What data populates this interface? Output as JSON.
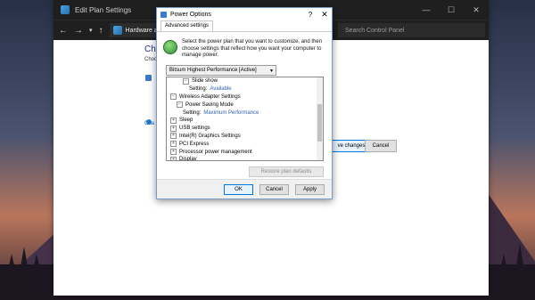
{
  "explorer": {
    "title": "Edit Plan Settings",
    "window_buttons": {
      "minimize": "—",
      "maximize": "☐",
      "close": "✕"
    },
    "nav": {
      "back": "←",
      "forward": "→",
      "up": "↑",
      "recent": "▾"
    },
    "breadcrumb": [
      "Hardware and S"
    ],
    "search_placeholder": "Search Control Panel",
    "heading": "Cha",
    "subheading": "Choo",
    "link": "Cha",
    "save_button": "ve changes",
    "cancel_button": "Cancel"
  },
  "dialog": {
    "title": "Power Options",
    "help": "?",
    "close": "✕",
    "tab": "Advanced settings",
    "description": "Select the power plan that you want to customize, and then choose settings that reflect how you want your computer to manage power.",
    "plan_selected": "Bitsum Highest Performance [Active]",
    "tree": [
      {
        "expander": "⊟",
        "label": "Slide show",
        "indent": 2,
        "value": ""
      },
      {
        "expander": "",
        "label": "Setting:",
        "indent": 3,
        "value": "Available"
      },
      {
        "expander": "⊟",
        "label": "Wireless Adapter Settings",
        "indent": 0,
        "value": ""
      },
      {
        "expander": "⊟",
        "label": "Power Saving Mode",
        "indent": 1,
        "value": ""
      },
      {
        "expander": "",
        "label": "Setting:",
        "indent": 2,
        "value": "Maximum Performance"
      },
      {
        "expander": "⊞",
        "label": "Sleep",
        "indent": 0,
        "value": ""
      },
      {
        "expander": "⊞",
        "label": "USB settings",
        "indent": 0,
        "value": ""
      },
      {
        "expander": "⊞",
        "label": "Intel(R) Graphics Settings",
        "indent": 0,
        "value": ""
      },
      {
        "expander": "⊞",
        "label": "PCI Express",
        "indent": 0,
        "value": ""
      },
      {
        "expander": "⊞",
        "label": "Processor power management",
        "indent": 0,
        "value": ""
      },
      {
        "expander": "⊞",
        "label": "Display",
        "indent": 0,
        "value": ""
      }
    ],
    "restore_button": "Restore plan defaults",
    "ok_button": "OK",
    "cancel_button": "Cancel",
    "apply_button": "Apply"
  }
}
